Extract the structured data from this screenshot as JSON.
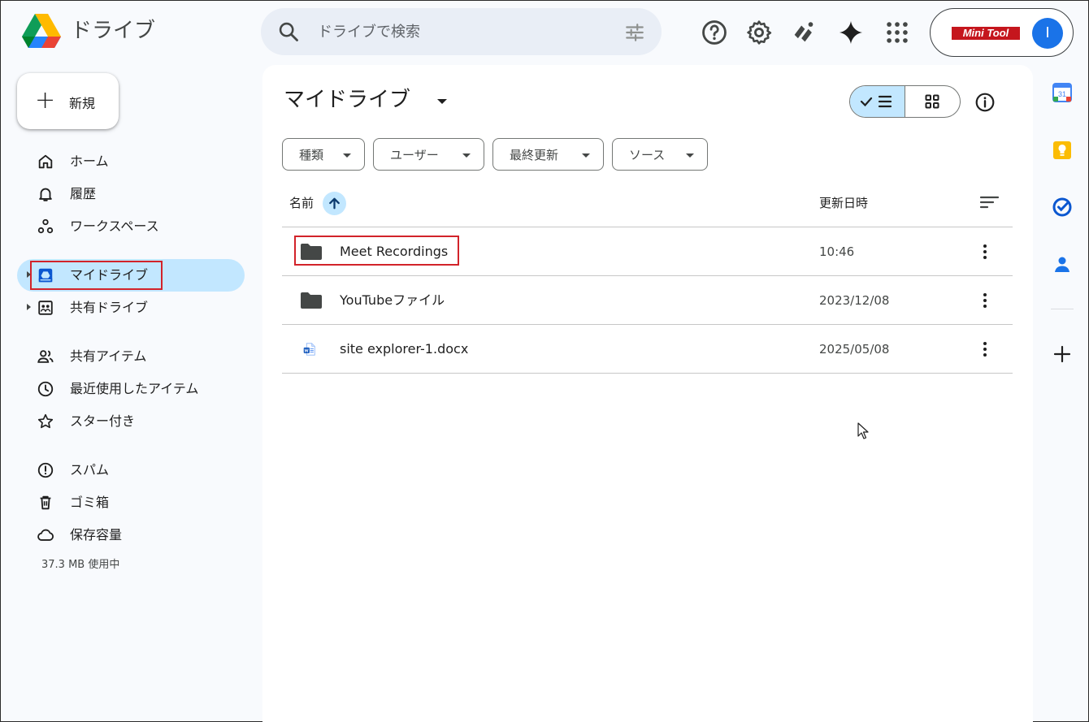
{
  "header": {
    "app_title": "ドライブ",
    "search_placeholder": "ドライブで検索",
    "brand_badge": "Mini Tool",
    "avatar_letter": "I"
  },
  "sidebar": {
    "new_label": "新規",
    "items": [
      {
        "label": "ホーム",
        "icon": "home-icon"
      },
      {
        "label": "履歴",
        "icon": "bell-icon"
      },
      {
        "label": "ワークスペース",
        "icon": "workspace-icon"
      },
      {
        "label": "マイドライブ",
        "icon": "my-drive-icon",
        "active": true
      },
      {
        "label": "共有ドライブ",
        "icon": "shared-drive-icon"
      },
      {
        "label": "共有アイテム",
        "icon": "people-icon"
      },
      {
        "label": "最近使用したアイテム",
        "icon": "clock-icon"
      },
      {
        "label": "スター付き",
        "icon": "star-icon"
      },
      {
        "label": "スパム",
        "icon": "spam-icon"
      },
      {
        "label": "ゴミ箱",
        "icon": "trash-icon"
      },
      {
        "label": "保存容量",
        "icon": "cloud-icon"
      }
    ],
    "storage_text": "37.3 MB 使用中"
  },
  "main": {
    "title": "マイドライブ",
    "filters": [
      "種類",
      "ユーザー",
      "最終更新",
      "ソース"
    ],
    "columns": {
      "name": "名前",
      "modified": "更新日時"
    },
    "files": [
      {
        "name": "Meet Recordings",
        "modified": "10:46",
        "type": "folder",
        "highlighted": true
      },
      {
        "name": "YouTubeファイル",
        "modified": "2023/12/08",
        "type": "folder"
      },
      {
        "name": "site explorer-1.docx",
        "modified": "2025/05/08",
        "type": "docx"
      }
    ]
  },
  "colors": {
    "accent_active": "#c2e7ff",
    "highlight_red": "#d2232a",
    "search_bg": "#e9eef6",
    "avatar_blue": "#1a73e8"
  }
}
